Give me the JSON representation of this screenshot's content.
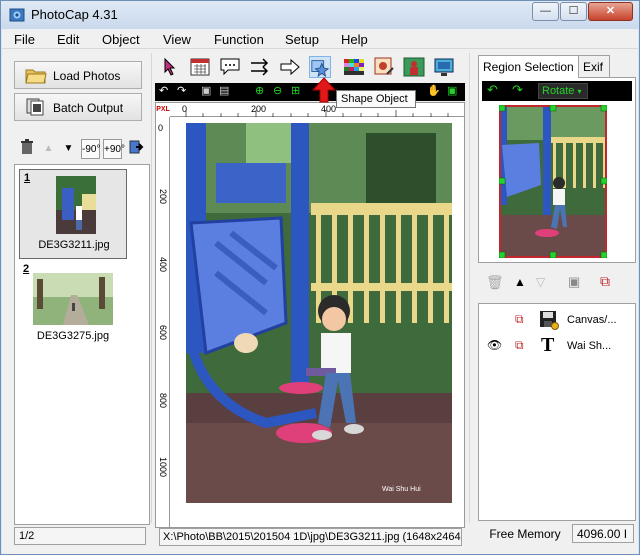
{
  "window": {
    "title": "PhotoCap 4.31",
    "min_glyph": "—",
    "max_glyph": "☐",
    "close_glyph": "✕"
  },
  "menu": [
    "File",
    "Edit",
    "Object",
    "View",
    "Function",
    "Setup",
    "Help"
  ],
  "left_panel": {
    "load_photos": "Load Photos",
    "batch_output": "Batch Output",
    "small_toolbar": [
      "-90°",
      "+90°"
    ],
    "thumbnails": [
      {
        "index": "1",
        "filename": "DE3G3211.jpg"
      },
      {
        "index": "2",
        "filename": "DE3G3275.jpg"
      }
    ],
    "page_status": "1/2"
  },
  "center": {
    "tooltip": "Shape Object",
    "ruler_unit": "PXL",
    "ruler_h_labels": [
      "0",
      "200",
      "400"
    ],
    "ruler_v_labels": [
      "0",
      "200",
      "400",
      "600",
      "800",
      "1000"
    ],
    "photo_caption_text": "Wai  Shu  Hui",
    "status_path": "X:\\Photo\\BB\\2015\\201504 1D\\jpg\\DE3G3211.jpg (1648x2464x"
  },
  "right_panel": {
    "tabs": [
      "Region Selection",
      "Exif"
    ],
    "rotate_label": "Rotate",
    "layers": [
      {
        "text": "Canvas/...",
        "icon": "floppy-disk-icon"
      },
      {
        "text": "Wai    Sh...",
        "icon": "text-t-icon"
      }
    ],
    "free_memory_label": "Free Memory",
    "free_memory_value": "4096.00 I"
  },
  "colors": {
    "accent_green": "#25d12a",
    "selection_red": "#c0282d",
    "title_bg": "#d7e4f2"
  }
}
